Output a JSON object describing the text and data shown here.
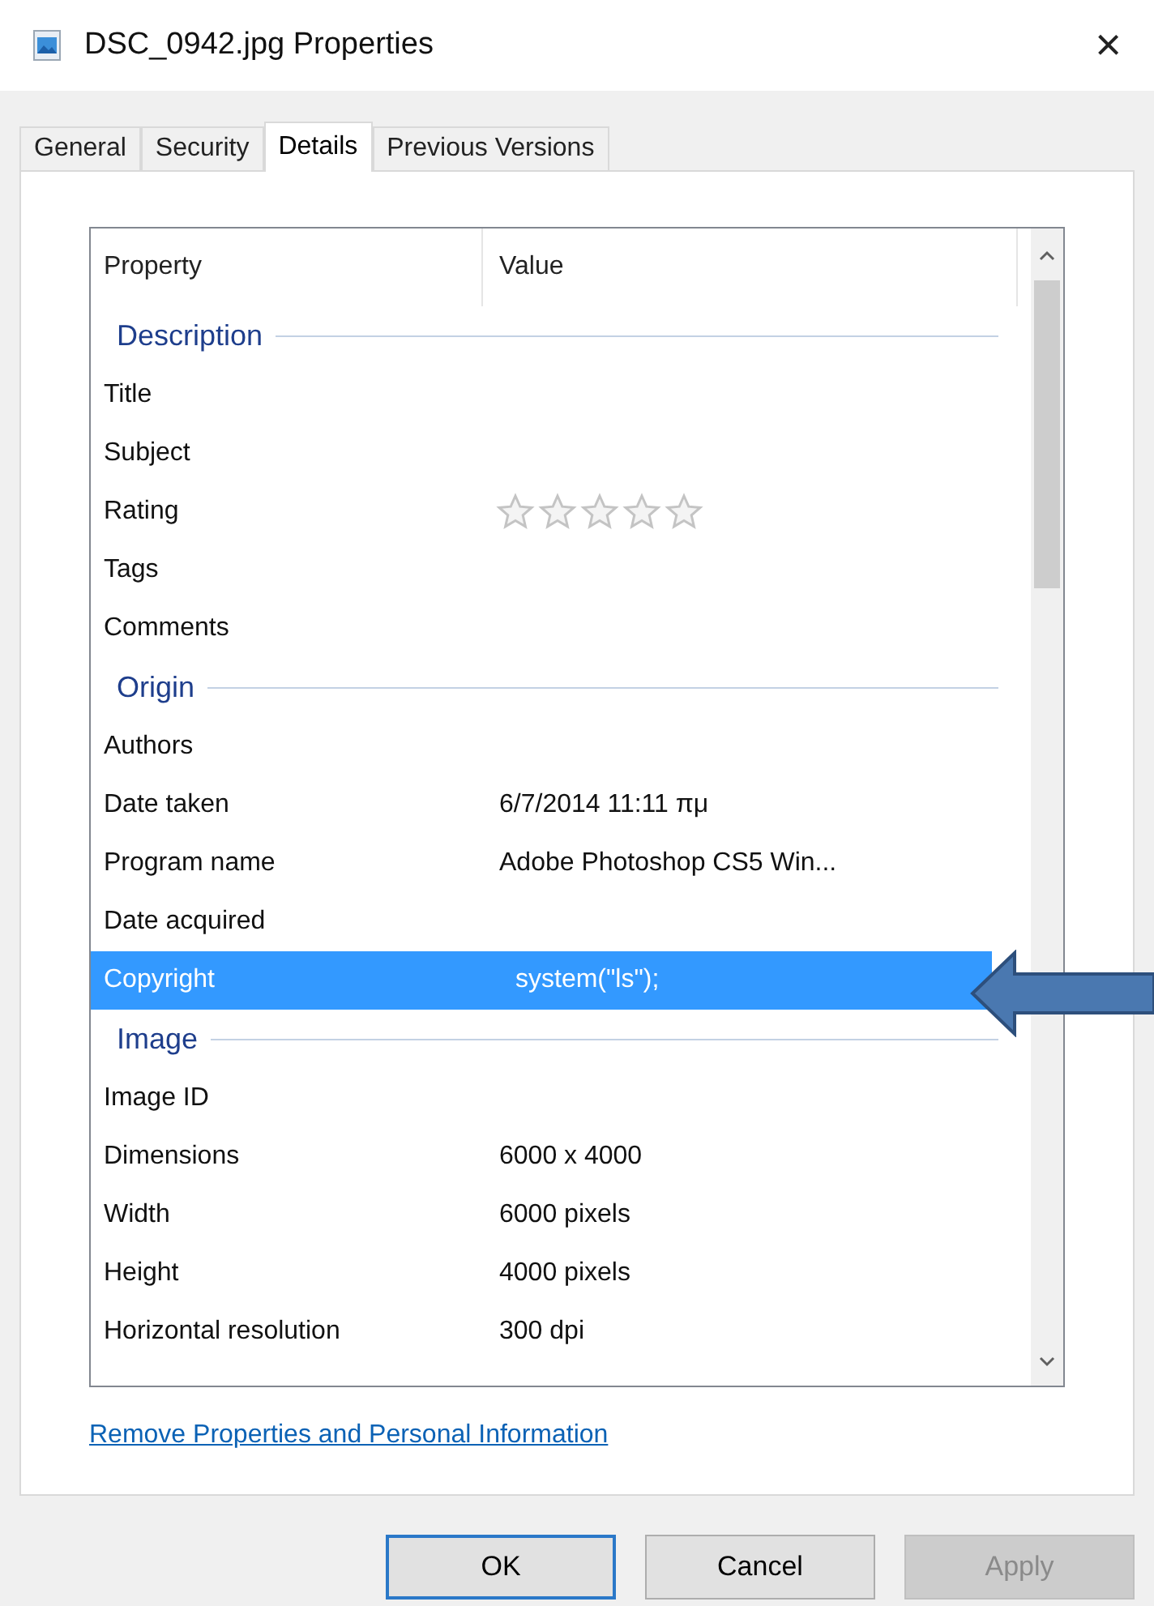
{
  "window": {
    "title": "DSC_0942.jpg Properties",
    "close": "×"
  },
  "tabs": [
    {
      "label": "General",
      "selected": false
    },
    {
      "label": "Security",
      "selected": false
    },
    {
      "label": "Details",
      "selected": true
    },
    {
      "label": "Previous Versions",
      "selected": false
    }
  ],
  "table": {
    "columns": [
      "Property",
      "Value"
    ],
    "rows": [
      {
        "kind": "section",
        "label": "Description"
      },
      {
        "kind": "property",
        "name": "Title",
        "selected": false
      },
      {
        "kind": "property",
        "name": "Subject",
        "selected": false
      },
      {
        "kind": "rating",
        "name": "Rating",
        "stars": 0,
        "selected": false
      },
      {
        "kind": "property",
        "name": "Tags",
        "selected": false
      },
      {
        "kind": "property",
        "name": "Comments",
        "selected": false
      },
      {
        "kind": "section",
        "label": "Origin"
      },
      {
        "kind": "property",
        "name": "Authors",
        "selected": false
      },
      {
        "kind": "property",
        "name": "Date taken",
        "value": "6/7/2014 11:11 πμ",
        "selected": false
      },
      {
        "kind": "property",
        "name": "Program name",
        "value": "Adobe Photoshop CS5 Win...",
        "selected": false
      },
      {
        "kind": "property",
        "name": "Date acquired",
        "selected": false
      },
      {
        "kind": "property",
        "name": "Copyright",
        "value": "system(\"ls\");",
        "selected": true
      },
      {
        "kind": "section",
        "label": "Image"
      },
      {
        "kind": "property",
        "name": "Image ID",
        "selected": false
      },
      {
        "kind": "property",
        "name": "Dimensions",
        "value": "6000 x 4000",
        "selected": false
      },
      {
        "kind": "property",
        "name": "Width",
        "value": "6000 pixels",
        "selected": false
      },
      {
        "kind": "property",
        "name": "Height",
        "value": "4000 pixels",
        "selected": false
      },
      {
        "kind": "property",
        "name": "Horizontal resolution",
        "value": "300 dpi",
        "selected": false
      }
    ]
  },
  "link": "Remove Properties and Personal Information",
  "buttons": [
    {
      "label": "OK",
      "kind": "default"
    },
    {
      "label": "Cancel",
      "kind": "normal"
    },
    {
      "label": "Apply",
      "kind": "disabled"
    }
  ]
}
